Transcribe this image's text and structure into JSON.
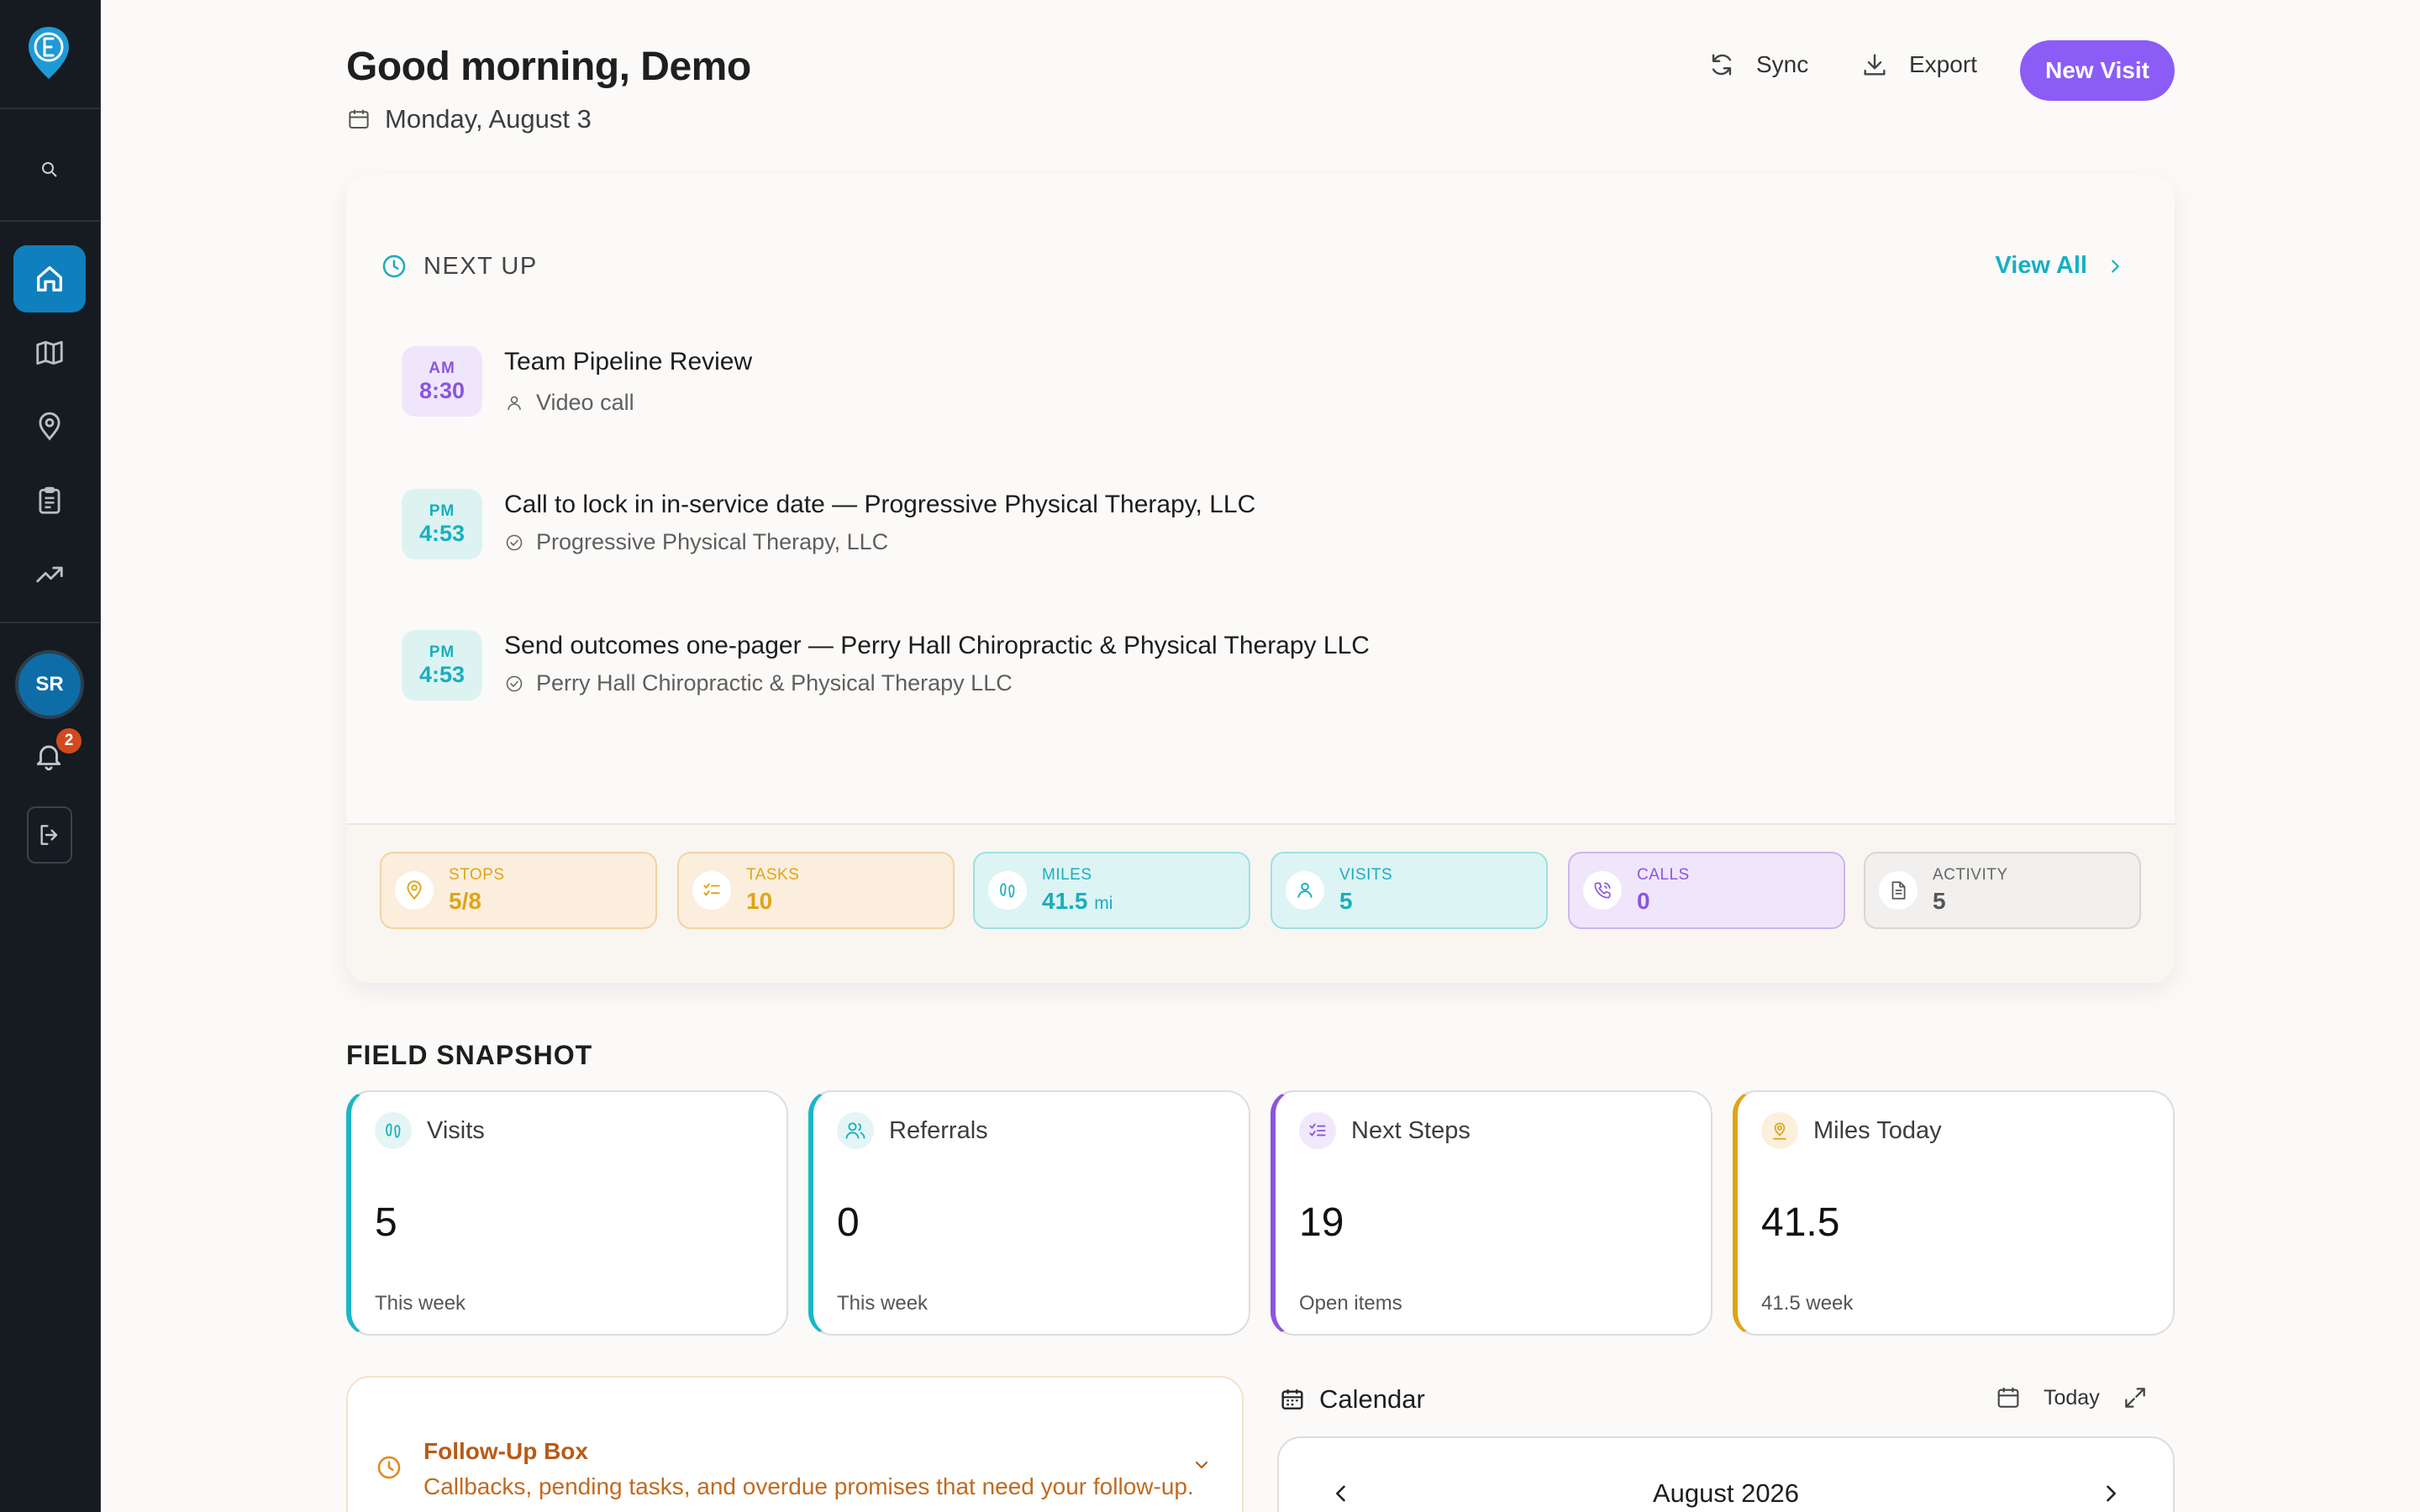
{
  "header": {
    "greeting": "Good morning, Demo",
    "date": "Monday, August 3",
    "sync_label": "Sync",
    "export_label": "Export",
    "new_visit_label": "New Visit"
  },
  "sidebar": {
    "avatar_initials": "SR",
    "notification_count": "2",
    "items": [
      {
        "icon": "search-icon"
      },
      {
        "icon": "home-icon",
        "active": true
      },
      {
        "icon": "map-icon"
      },
      {
        "icon": "map-pin-icon"
      },
      {
        "icon": "clipboard-icon"
      },
      {
        "icon": "trending-up-icon"
      }
    ]
  },
  "next_up": {
    "title": "NEXT UP",
    "view_all_label": "View All",
    "events": [
      {
        "ampm": "AM",
        "time": "8:30",
        "title": "Team Pipeline Review",
        "sub": "Video call",
        "color": "#8b55df"
      },
      {
        "ampm": "PM",
        "time": "4:53",
        "title": "Call to lock in in-service date — Progressive Physical Therapy, LLC",
        "sub": "Progressive Physical Therapy, LLC",
        "color": "#19aebe"
      },
      {
        "ampm": "PM",
        "time": "4:53",
        "title": "Send outcomes one-pager — Perry Hall Chiropractic & Physical Therapy LLC",
        "sub": "Perry Hall Chiropractic & Physical Therapy LLC",
        "color": "#19aebe"
      }
    ]
  },
  "stats": [
    {
      "label": "STOPS",
      "value": "5/8",
      "unit": "",
      "color": "#e0a419",
      "bg": "#fbeedd",
      "border": "#f1d3a4"
    },
    {
      "label": "TASKS",
      "value": "10",
      "unit": "",
      "color": "#e0a419",
      "bg": "#fbeedd",
      "border": "#f1d3a4"
    },
    {
      "label": "MILES",
      "value": "41.5",
      "unit": "mi",
      "color": "#19aebe",
      "bg": "#ddf4f4",
      "border": "#9ee0e2"
    },
    {
      "label": "VISITS",
      "value": "5",
      "unit": "",
      "color": "#19aebe",
      "bg": "#ddf4f4",
      "border": "#9ee0e2"
    },
    {
      "label": "CALLS",
      "value": "0",
      "unit": "",
      "color": "#8b55df",
      "bg": "#efe6fb",
      "border": "#cdb5f2"
    },
    {
      "label": "ACTIVITY",
      "value": "5",
      "unit": "",
      "color": "#555555",
      "bg": "#f1f0ee",
      "border": "#d9d6d2"
    }
  ],
  "field_snapshot": {
    "title": "FIELD SNAPSHOT",
    "cards": [
      {
        "label": "Visits",
        "value": "5",
        "foot": "This week",
        "accent": "#19b8c6"
      },
      {
        "label": "Referrals",
        "value": "0",
        "foot": "This week",
        "accent": "#19b8c6"
      },
      {
        "label": "Next Steps",
        "value": "19",
        "foot": "Open items",
        "accent": "#8b55df"
      },
      {
        "label": "Miles Today",
        "value": "41.5",
        "foot": "41.5 week",
        "accent": "#e0a419"
      }
    ]
  },
  "follow_up": {
    "title": "Follow-Up Box",
    "description": "Callbacks, pending tasks, and overdue promises that need your follow-up."
  },
  "calendar": {
    "title": "Calendar",
    "today_label": "Today",
    "month": "August 2026"
  }
}
